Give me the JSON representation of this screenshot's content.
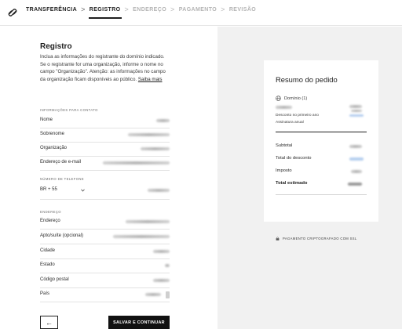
{
  "breadcrumb": {
    "steps": [
      {
        "label": "TRANSFERÊNCIA"
      },
      {
        "label": "REGISTRO"
      },
      {
        "label": "ENDEREÇO"
      },
      {
        "label": "PAGAMENTO"
      },
      {
        "label": "REVISÃO"
      }
    ],
    "active_step": "REGISTRO",
    "separator": ">"
  },
  "form": {
    "title": "Registro",
    "description": "Inclua as informações do registrante do domínio indicado. Se o registrante for uma organização, informe o nome no campo \"Organização\". Atenção: as informações no campo da organização ficam disponíveis ao público.",
    "learn_more": "Saiba mais",
    "contact_section": "INFORMAÇÕES PARA CONTATO",
    "phone_section": "NÚMERO DE TELEFONE",
    "address_section": "ENDEREÇO",
    "contact_fields": [
      {
        "label": "Nome"
      },
      {
        "label": "Sobrenome"
      },
      {
        "label": "Organização"
      },
      {
        "label": "Endereço de e-mail"
      }
    ],
    "phone_country": "BR + 55",
    "address_fields": [
      {
        "label": "Endereço"
      },
      {
        "label": "Apto/suíte (opcional)"
      },
      {
        "label": "Cidade"
      },
      {
        "label": "Estado"
      },
      {
        "label": "Código postal"
      },
      {
        "label": "País"
      }
    ],
    "back_icon": "←",
    "save_label": "SALVAR E CONTINUAR"
  },
  "summary": {
    "title": "Resumo do pedido",
    "domain_label": "Domínio (1)",
    "discount_note": "Desconto no primeiro ano",
    "subscription_note": "Assinatura anual",
    "subtotal_label": "Subtotal",
    "discount_total_label": "Total do desconto",
    "tax_label": "Imposto",
    "estimated_total_label": "Total estimado",
    "secure_label": "PAGAMENTO CRIPTOGRAFADO COM SSL"
  },
  "colors": {
    "accent": "#111111",
    "discount_blur": "#a9c6ec",
    "panel_bg": "#f1f1f1"
  }
}
